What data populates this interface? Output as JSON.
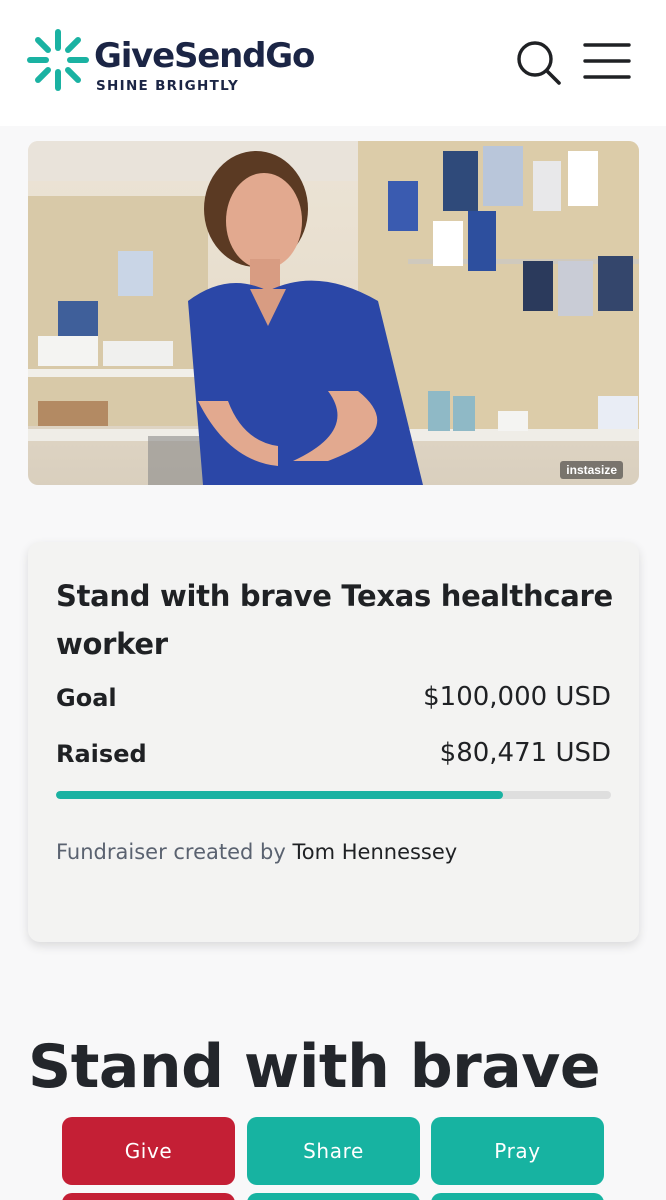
{
  "header": {
    "brand": "GiveSendGo",
    "tagline": "SHINE BRIGHTLY",
    "logo_icon": "sunburst-logo-icon",
    "search_icon": "search-icon",
    "menu_icon": "hamburger-menu-icon",
    "brand_color": "#1ab2a2"
  },
  "hero": {
    "watermark": "instasize"
  },
  "campaign": {
    "title": "Stand with brave Texas healthcare worker",
    "goal_label": "Goal",
    "goal_value": "$100,000 USD",
    "raised_label": "Raised",
    "raised_value": "$80,471 USD",
    "progress_fraction": 0.80471,
    "creator_prefix": "Fundraiser created by ",
    "creator_name": "Tom Hennessey"
  },
  "page_heading": "Stand with brave",
  "actions": {
    "give_label": "Give",
    "share_label": "Share",
    "pray_label": "Pray",
    "give_color": "#c41f35",
    "teal_color": "#17b3a1"
  }
}
